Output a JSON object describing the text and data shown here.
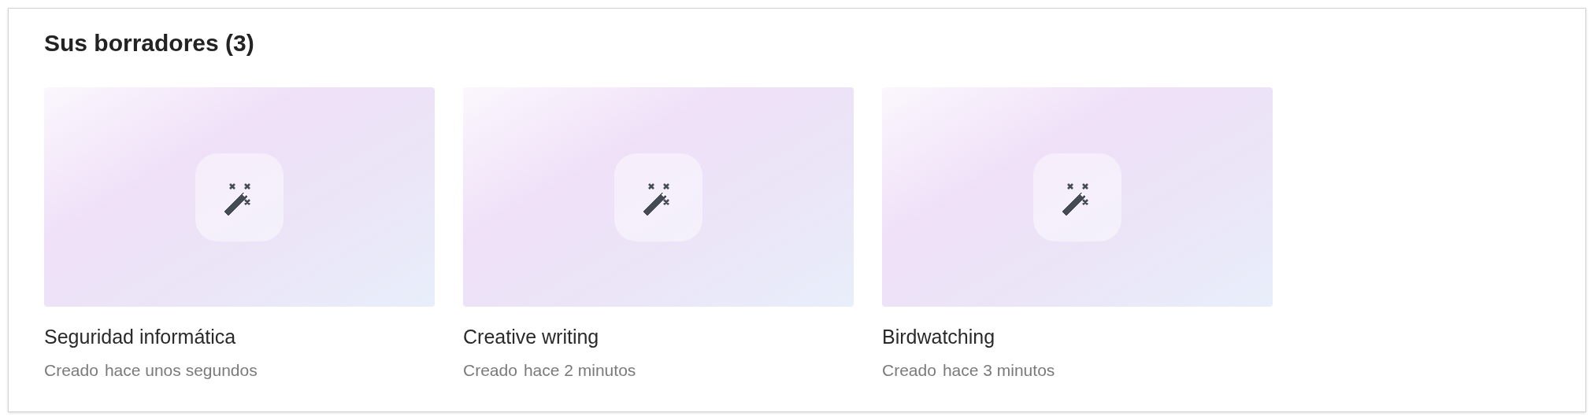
{
  "section": {
    "title": "Sus borradores (3)"
  },
  "drafts": [
    {
      "title": "Seguridad informática",
      "created_label": "Creado",
      "time": "hace unos segundos"
    },
    {
      "title": "Creative writing",
      "created_label": "Creado",
      "time": "hace 2 minutos"
    },
    {
      "title": "Birdwatching",
      "created_label": "Creado",
      "time": "hace 3 minutos"
    }
  ]
}
